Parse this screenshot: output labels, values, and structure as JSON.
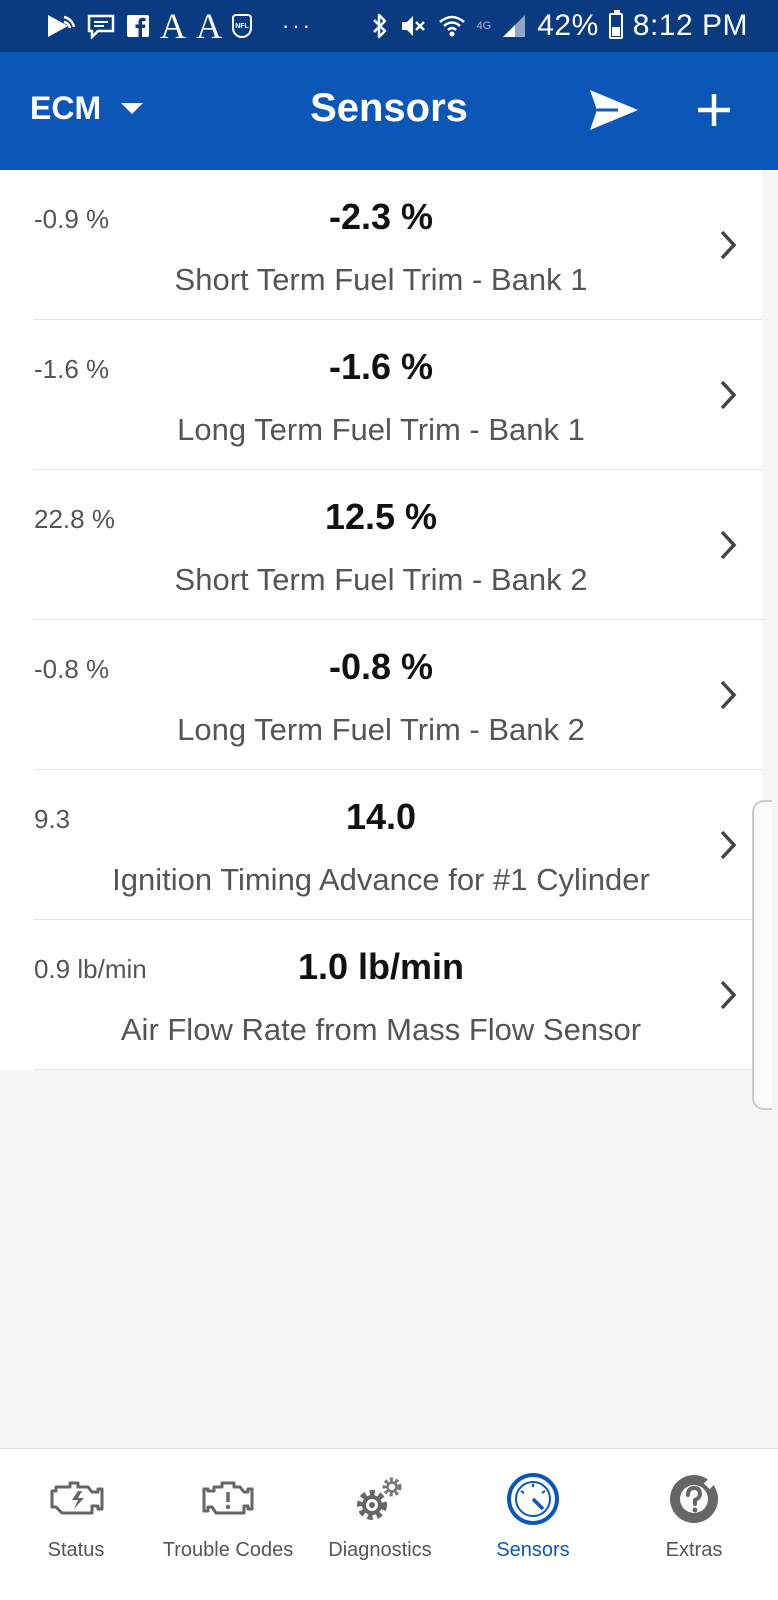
{
  "status_bar": {
    "font_a_1": "A",
    "font_a_2": "A",
    "nfl_badge": "NFL",
    "more": "···",
    "network": "4G",
    "battery": "42%",
    "time": "8:12 PM",
    "icons": [
      "cast-icon",
      "message-icon",
      "facebook-icon",
      "font-a-icon",
      "font-a-icon",
      "nfl-icon",
      "bluetooth-icon",
      "mute-icon",
      "wifi-icon",
      "signal-icon",
      "battery-icon"
    ]
  },
  "app_bar": {
    "module": "ECM",
    "title": "Sensors",
    "icons": [
      "dropdown-caret-icon",
      "send-icon",
      "add-icon"
    ],
    "color": "#0b57b8"
  },
  "sensors": [
    {
      "min": "-0.9 %",
      "value": "-2.3 %",
      "name": "Short Term Fuel Trim - Bank 1"
    },
    {
      "min": "-1.6 %",
      "value": "-1.6 %",
      "name": "Long Term Fuel Trim - Bank 1"
    },
    {
      "min": "22.8 %",
      "value": "12.5 %",
      "name": "Short Term Fuel Trim - Bank 2"
    },
    {
      "min": "-0.8 %",
      "value": "-0.8 %",
      "name": "Long Term Fuel Trim - Bank 2"
    },
    {
      "min": "9.3",
      "value": "14.0",
      "name": "Ignition Timing Advance for #1 Cylinder"
    },
    {
      "min": "0.9 lb/min",
      "value": "1.0 lb/min",
      "name": "Air Flow Rate from Mass Flow Sensor"
    }
  ],
  "bottom_nav": {
    "active": "Sensors",
    "active_color": "#0b57b8",
    "items": [
      {
        "label": "Status",
        "icon": "engine-status-icon"
      },
      {
        "label": "Trouble Codes",
        "icon": "check-engine-icon"
      },
      {
        "label": "Diagnostics",
        "icon": "gears-icon"
      },
      {
        "label": "Sensors",
        "icon": "gauge-icon"
      },
      {
        "label": "Extras",
        "icon": "help-lifebuoy-icon"
      }
    ]
  }
}
